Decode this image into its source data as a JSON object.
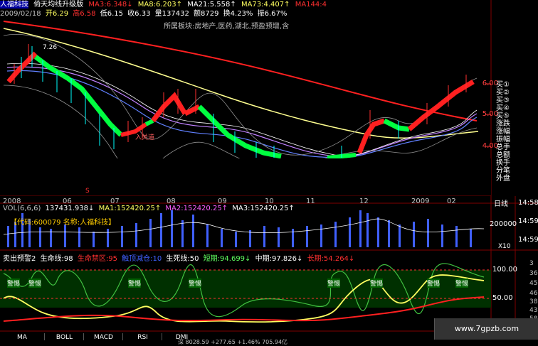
{
  "header": {
    "stock_name": "人福科技",
    "indicator_name": "倚天均线升级版",
    "ma3": "MA3:6.348↓",
    "ma8": "MA8:6.203↑",
    "ma21": "MA21:5.558↑",
    "ma73": "MA73:4.407↑",
    "ma144": "MA144:4"
  },
  "quote": {
    "date": "2009/02/18",
    "open": "开6.29",
    "high": "高6.58",
    "low": "低6.15",
    "close": "收6.33",
    "volume": "量137432",
    "amount": "额8729",
    "turnover": "换4.23%",
    "amplitude": "振6.67%"
  },
  "sector": "所属板块:房地产,医药,湖北,预盈预增,含",
  "annotations": {
    "peak_label": "7.26",
    "buy_label": "入关道",
    "s_marker": "S"
  },
  "price_axis": [
    "6.00",
    "5.00",
    "4.00"
  ],
  "right_menu": [
    "买①",
    "买②",
    "买③",
    "买④",
    "买⑤",
    "涨跌",
    "涨幅",
    "振幅",
    "总手",
    "总额",
    "换手",
    "分笔",
    "外盘"
  ],
  "date_axis": [
    "2008",
    "06",
    "07",
    "08",
    "09",
    "10",
    "11",
    "12",
    "2009",
    "02"
  ],
  "period_label": "日线",
  "volume": {
    "label": "VOL(6,6,6)",
    "vol": "137431.938↓",
    "ma1": "MA1:152420.25↑",
    "ma2": "MA2:152420.25↑",
    "ma3": "MA3:152420.25↑",
    "code_text": "【代码:600079 名称:人福科技】",
    "axis_top": "200000",
    "axis_unit": "X10"
  },
  "indicator": {
    "name": "卖出预警2",
    "life_line": "生命线:98",
    "life_zone": "生命禁区:95",
    "bottom": "触顶减仓:10",
    "death_line": "生死线:50",
    "short": "短期:94.699↓",
    "mid": "中期:97.826↓",
    "long": "长期:54.264↓",
    "axis_100": "100.00",
    "axis_50": "50.00",
    "alert_label": "警惕"
  },
  "tabs": [
    "MA",
    "BOLL",
    "MACD",
    "RSI",
    "DMI"
  ],
  "right_time_labels": [
    "14:58",
    "14:59",
    "14:59"
  ],
  "right_side_nums": [
    "3",
    "36",
    "45",
    "46",
    "38",
    "43",
    "58"
  ],
  "watermark": "www.7gpzb.com",
  "status_text": "深 8028.59 +277.65 +1.46% 705.94亿",
  "colors": {
    "red": "#ff3030",
    "green": "#00ff40",
    "yellow": "#ffff80",
    "purple": "#c080ff",
    "blue": "#4080ff"
  }
}
